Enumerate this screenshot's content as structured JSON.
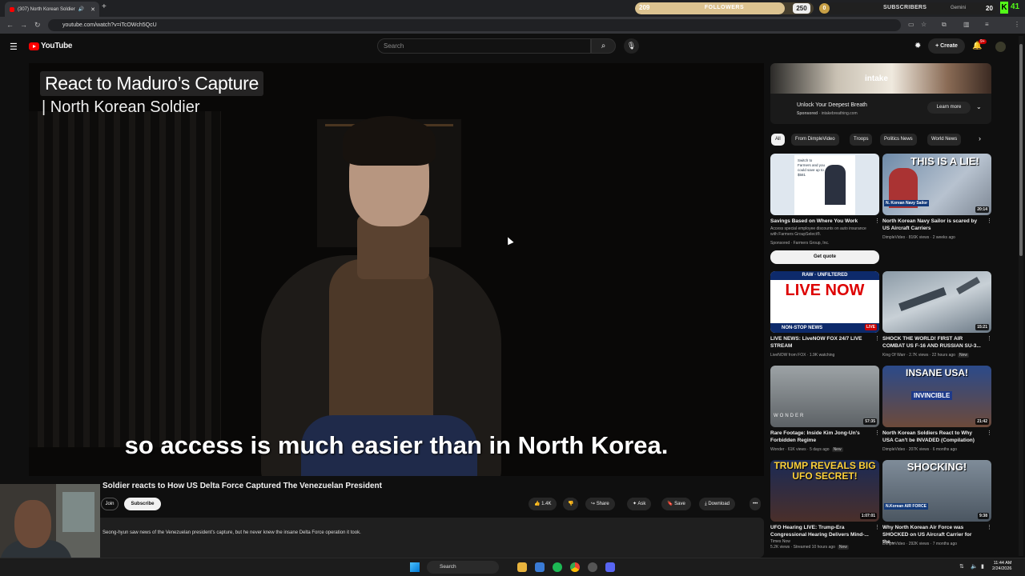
{
  "browser": {
    "tab_title": "(307) North Korean Soldier",
    "url": "youtube.com/watch?v=iTcOWch5QcU"
  },
  "overlays": {
    "followers": {
      "current": "209",
      "label": "FOLLOWERS",
      "goal": "250",
      "progress": 0.84
    },
    "subscribers": {
      "current": "0",
      "label": "SUBSCRIBERS",
      "tag": "Gemini",
      "goal": "20"
    },
    "kick": {
      "letter": "K",
      "count": "41"
    }
  },
  "youtube": {
    "logo_text": "YouTube",
    "search_placeholder": "Search",
    "create_label": "Create",
    "notif_badge": "9+"
  },
  "video": {
    "overlay_title": "React to Maduro’s Capture",
    "overlay_subtitle": "|  North Korean Soldier",
    "caption": "so access is much easier than in North Korea.",
    "title": "Soldier reacts to How US Delta Force Captured The Venezuelan President",
    "join": "Join",
    "subscribe": "Subscribe",
    "likes": "1.4K",
    "share": "Share",
    "ask": "Ask",
    "save": "Save",
    "download": "Download",
    "description": "Seong-hyun saw news of the Venezuelan president’s capture, but he never knew the insane Delta Force operation it took."
  },
  "ad": {
    "brand": "intake",
    "title": "Unlock Your Deepest Breath",
    "sponsored": "Sponsored",
    "domain": "intakebreathing.com",
    "cta": "Learn more"
  },
  "chips": [
    "All",
    "From DimpleVideo",
    "Troops",
    "Politics News",
    "World News"
  ],
  "cards": [
    {
      "title": "Savings Based on Where You Work",
      "line1": "Access special employee discounts on auto insurance with Farmers GroupSelect®.",
      "line2": "Sponsored · Farmers Group, Inc.",
      "duration": "",
      "thumb_text": "Switch to Farmers and you could save up to $581",
      "cta": "Get quote"
    },
    {
      "title": "North Korean Navy Sailor is scared by US Aircraft Carriers",
      "line1": "DimpleVideo · 816K views · 2 weeks ago",
      "duration": "20:14",
      "thumb_text": "THIS IS A LIE!",
      "thumb_sub": "N. Korean Navy Sailor"
    },
    {
      "title": "LIVE NEWS: LiveNOW FOX 24/7 LIVE STREAM",
      "line1": "LiveNOW from FOX · 1.9K watching",
      "duration": "LIVE",
      "thumb_top": "RAW · UNFILTERED",
      "thumb_text": "LIVE NOW",
      "thumb_sub": "NON-STOP NEWS"
    },
    {
      "title": "SHOCK THE WORLD! FIRST AIR COMBAT US F-16 AND RUSSIAN SU-3...",
      "line1": "King Of Warr · 2.7K views · 22 hours ago",
      "new": "New",
      "duration": "15:21"
    },
    {
      "title": "Rare Footage: Inside Kim Jong-Un's Forbidden Regime",
      "line1": "Wonder · 61K views · 5 days ago",
      "new": "New",
      "duration": "57:35",
      "thumb_sub": "WONDER"
    },
    {
      "title": "North Korean Soldiers React to Why USA Can't be INVADED (Compilation)",
      "line1": "DimpleVideo · 207K views · 6 months ago",
      "duration": "21:42",
      "thumb_text": "INSANE USA!",
      "thumb_sub": "INVINCIBLE"
    },
    {
      "title": "UFO Hearing LIVE: Trump-Era Congressional Hearing Delivers Mind-...",
      "line1": "Times Now",
      "line2": "5.2K views · Streamed 10 hours ago",
      "new": "New",
      "duration": "1:07:01",
      "thumb_text": "TRUMP REVEALS BIG UFO SECRET!"
    },
    {
      "title": "Why North Korean Air Force was SHOCKED on US Aircraft Carrier for the...",
      "line1": "DimpleVideo · 292K views · 7 months ago",
      "duration": "9:38",
      "thumb_text": "SHOCKING!",
      "thumb_sub": "N.Korean AIR FORCE"
    }
  ],
  "taskbar": {
    "search": "Search",
    "time": "11:44 AM",
    "date": "2/24/2026"
  }
}
